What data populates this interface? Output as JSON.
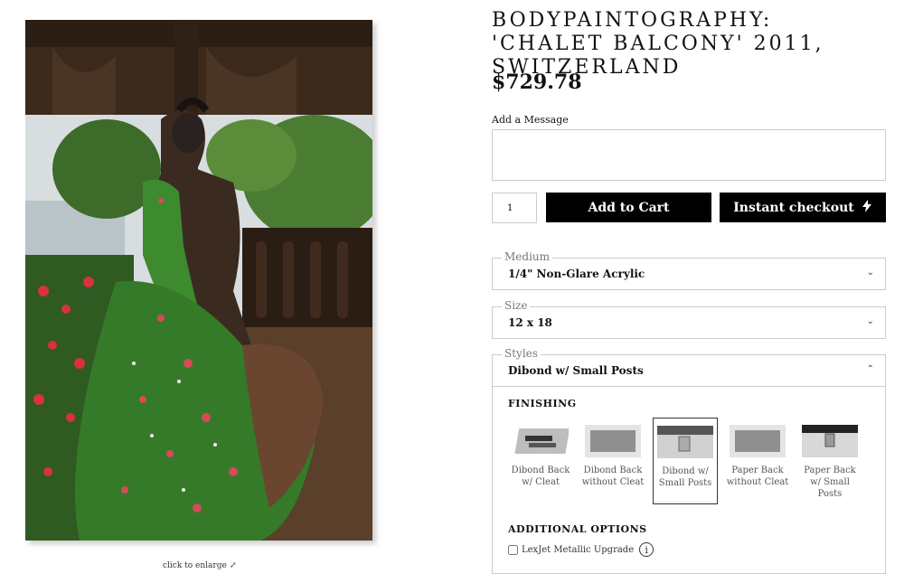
{
  "product": {
    "title": "BODYPAINTOGRAPHY: 'CHALET BALCONY' 2011, SWITZERLAND",
    "price": "$729.78",
    "enlarge_text": "click to enlarge"
  },
  "message": {
    "label": "Add a Message",
    "value": ""
  },
  "purchase": {
    "quantity": "1",
    "add_to_cart": "Add to Cart",
    "instant_checkout": "Instant checkout"
  },
  "options": {
    "medium": {
      "label": "Medium",
      "value": "1/4\" Non-Glare Acrylic"
    },
    "size": {
      "label": "Size",
      "value": "12 x 18"
    },
    "styles": {
      "label": "Styles",
      "value": "Dibond w/ Small Posts"
    }
  },
  "finishing": {
    "heading": "FINISHING",
    "items": [
      {
        "label": "Dibond Back w/ Cleat",
        "selected": false
      },
      {
        "label": "Dibond Back without Cleat",
        "selected": false
      },
      {
        "label": "Dibond w/ Small Posts",
        "selected": true
      },
      {
        "label": "Paper Back without Cleat",
        "selected": false
      },
      {
        "label": "Paper Back w/ Small Posts",
        "selected": false
      }
    ]
  },
  "additional": {
    "heading": "ADDITIONAL OPTIONS",
    "upgrade_label": "LexJet Metallic Upgrade",
    "upgrade_checked": false,
    "info_icon": "info-icon"
  },
  "colors": {
    "button_bg": "#000000",
    "button_text": "#ffffff",
    "border": "#cccccc"
  }
}
